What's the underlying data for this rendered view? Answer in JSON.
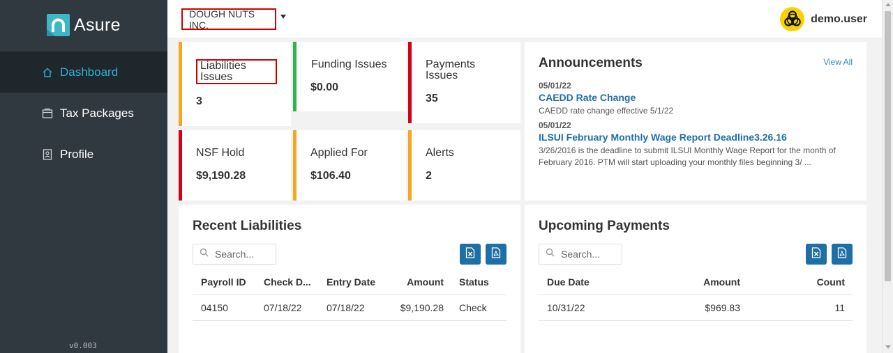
{
  "app": {
    "brand": "Asure",
    "version": "v0.003"
  },
  "sidebar": {
    "items": [
      {
        "label": "Dashboard",
        "icon": "home-icon",
        "active": true
      },
      {
        "label": "Tax Packages",
        "icon": "package-icon",
        "active": false
      },
      {
        "label": "Profile",
        "icon": "profile-icon",
        "active": false
      }
    ]
  },
  "header": {
    "company": "DOUGH NUTS INC.",
    "user": "demo.user",
    "avatar_icon": "biohazard-icon"
  },
  "stats": [
    {
      "title": "Liabilities Issues",
      "value": "3",
      "color": "#f5a623"
    },
    {
      "title": "Funding Issues",
      "value": "$0.00",
      "color": "#2fb34a"
    },
    {
      "title": "Payments Issues",
      "value": "35",
      "color": "#d0021b"
    },
    {
      "title": "NSF Hold",
      "value": "$9,190.28",
      "color": "#d0021b"
    },
    {
      "title": "Applied For",
      "value": "$106.40",
      "color": "#f5a623"
    },
    {
      "title": "Alerts",
      "value": "2",
      "color": "#f5a623"
    }
  ],
  "announcements": {
    "title": "Announcements",
    "view_all": "View All",
    "items": [
      {
        "date": "05/01/22",
        "headline": "CAEDD Rate Change",
        "body": "CAEDD rate change effective 5/1/22"
      },
      {
        "date": "05/01/22",
        "headline": "ILSUI February Monthly Wage Report Deadline3.26.16",
        "body": "3/26/2016 is the deadline to submit ILSUI Monthly Wage Report for the month of February 2016. PTM will start uploading your monthly files beginning 3/ ..."
      }
    ]
  },
  "recent_liabilities": {
    "title": "Recent Liabilities",
    "search_placeholder": "Search...",
    "columns": [
      "Payroll ID",
      "Check D...",
      "Entry Date",
      "Amount",
      "Status"
    ],
    "rows": [
      [
        "04150",
        "07/18/22",
        "07/18/22",
        "$9,190.28",
        "Check"
      ]
    ]
  },
  "upcoming_payments": {
    "title": "Upcoming Payments",
    "search_placeholder": "Search...",
    "columns": [
      "Due Date",
      "Amount",
      "Count"
    ],
    "rows": [
      [
        "10/31/22",
        "$969.83",
        "11"
      ]
    ]
  },
  "colors": {
    "sidebar_bg": "#303840",
    "sidebar_active_bg": "#1f262c",
    "accent": "#2ab3d6",
    "button_blue": "#1d6fa5",
    "highlight_red": "#d00000"
  }
}
